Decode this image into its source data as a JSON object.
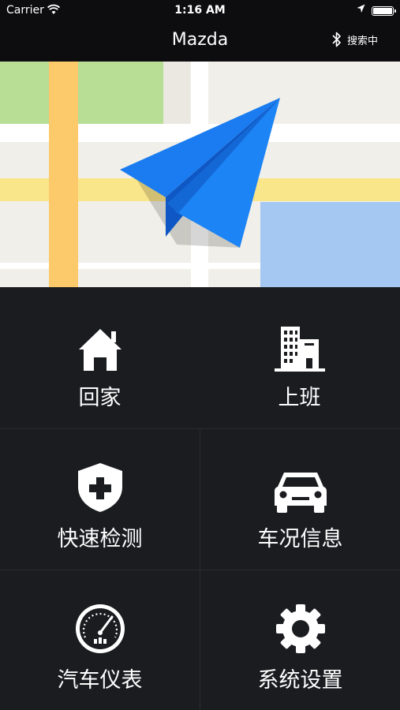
{
  "status_bar": {
    "carrier": "Carrier",
    "time": "1:16 AM"
  },
  "nav": {
    "title": "Mazda",
    "bluetooth_status": "搜索中"
  },
  "map": {
    "icon": "paper-plane-icon"
  },
  "menu": {
    "items": [
      {
        "label": "回家",
        "icon": "home-icon"
      },
      {
        "label": "上班",
        "icon": "office-building-icon"
      },
      {
        "label": "快速检测",
        "icon": "shield-plus-icon"
      },
      {
        "label": "车况信息",
        "icon": "car-icon"
      },
      {
        "label": "汽车仪表",
        "icon": "speedometer-icon"
      },
      {
        "label": "系统设置",
        "icon": "gear-icon"
      }
    ]
  },
  "colors": {
    "accent": "#1a7cf0",
    "background": "#1b1c20",
    "bar": "#0d0d10"
  }
}
